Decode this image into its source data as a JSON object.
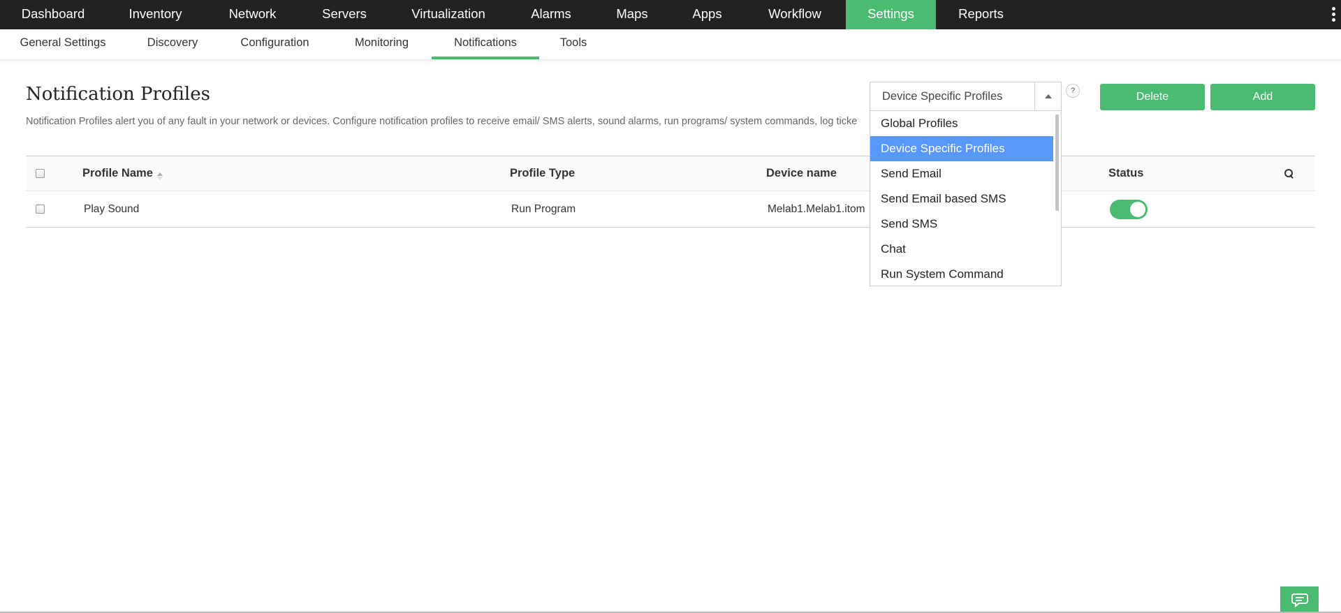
{
  "topnav": {
    "items": [
      {
        "label": "Dashboard"
      },
      {
        "label": "Inventory"
      },
      {
        "label": "Network"
      },
      {
        "label": "Servers"
      },
      {
        "label": "Virtualization"
      },
      {
        "label": "Alarms"
      },
      {
        "label": "Maps"
      },
      {
        "label": "Apps"
      },
      {
        "label": "Workflow"
      },
      {
        "label": "Settings",
        "active": true
      },
      {
        "label": "Reports"
      }
    ]
  },
  "subnav": {
    "items": [
      {
        "label": "General Settings"
      },
      {
        "label": "Discovery"
      },
      {
        "label": "Configuration"
      },
      {
        "label": "Monitoring"
      },
      {
        "label": "Notifications",
        "active": true
      },
      {
        "label": "Tools"
      }
    ]
  },
  "header": {
    "title": "Notification Profiles",
    "description": "Notification Profiles alert you of any fault in your network or devices. Configure notification profiles to receive email/ SMS alerts, sound alarms, run programs/ system commands, log ticke",
    "help": "?"
  },
  "filter": {
    "selected": "Device Specific Profiles",
    "options": [
      "Global Profiles",
      "Device Specific Profiles",
      "Send Email",
      "Send Email based SMS",
      "Send SMS",
      "Chat",
      "Run System Command"
    ]
  },
  "actions": {
    "delete_label": "Delete",
    "add_label": "Add"
  },
  "table": {
    "columns": {
      "profile_name": "Profile Name",
      "profile_type": "Profile Type",
      "device_name": "Device name",
      "status": "Status"
    },
    "rows": [
      {
        "profile_name": "Play Sound",
        "profile_type": "Run Program",
        "device_name": "Melab1.Melab1.itom",
        "status_enabled": true
      }
    ]
  },
  "colors": {
    "accent": "#4cbb72",
    "nav_bg": "#222222",
    "dropdown_highlight": "#5897fb"
  },
  "icons": {
    "menu": "kebab-menu-icon",
    "sort": "sort-icon",
    "search": "search-icon",
    "chat": "chat-icon",
    "dropdown": "caret-up-icon"
  }
}
